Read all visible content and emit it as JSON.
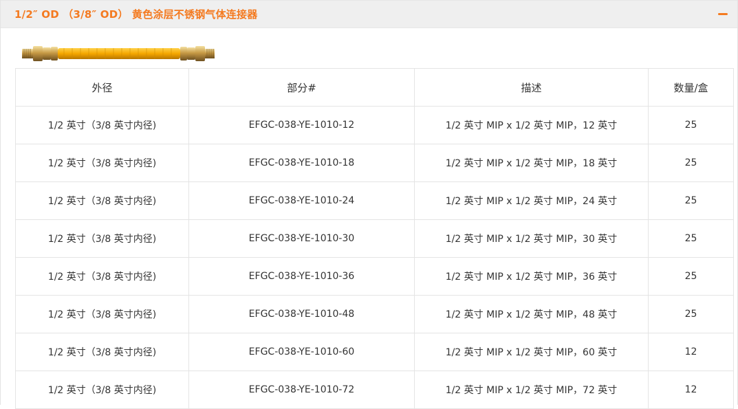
{
  "panel": {
    "title": "1/2″ OD （3/8″ OD） 黄色涂层不锈钢气体连接器",
    "collapse_icon": "minus-icon",
    "accent_color": "#f47a20",
    "header_bg": "#efefef",
    "image_desc_icon": "gas-connector-hose"
  },
  "table": {
    "headers": [
      "外径",
      "部分#",
      "描述",
      "数量/盒"
    ],
    "rows": [
      [
        "1/2 英寸（3/8 英寸内径)",
        "EFGC-038-YE-1010-12",
        "1/2 英寸 MIP x 1/2 英寸 MIP，12 英寸",
        "25"
      ],
      [
        "1/2 英寸（3/8 英寸内径)",
        "EFGC-038-YE-1010-18",
        "1/2 英寸 MIP x 1/2 英寸 MIP，18 英寸",
        "25"
      ],
      [
        "1/2 英寸（3/8 英寸内径)",
        "EFGC-038-YE-1010-24",
        "1/2 英寸 MIP x 1/2 英寸 MIP，24 英寸",
        "25"
      ],
      [
        "1/2 英寸（3/8 英寸内径)",
        "EFGC-038-YE-1010-30",
        "1/2 英寸 MIP x 1/2 英寸 MIP，30 英寸",
        "25"
      ],
      [
        "1/2 英寸（3/8 英寸内径)",
        "EFGC-038-YE-1010-36",
        "1/2 英寸 MIP x 1/2 英寸 MIP，36 英寸",
        "25"
      ],
      [
        "1/2 英寸（3/8 英寸内径)",
        "EFGC-038-YE-1010-48",
        "1/2 英寸 MIP x 1/2 英寸 MIP，48 英寸",
        "25"
      ],
      [
        "1/2 英寸（3/8 英寸内径)",
        "EFGC-038-YE-1010-60",
        "1/2 英寸 MIP x 1/2 英寸 MIP，60 英寸",
        "12"
      ],
      [
        "1/2 英寸（3/8 英寸内径)",
        "EFGC-038-YE-1010-72",
        "1/2 英寸 MIP x 1/2 英寸 MIP，72 英寸",
        "12"
      ]
    ]
  }
}
